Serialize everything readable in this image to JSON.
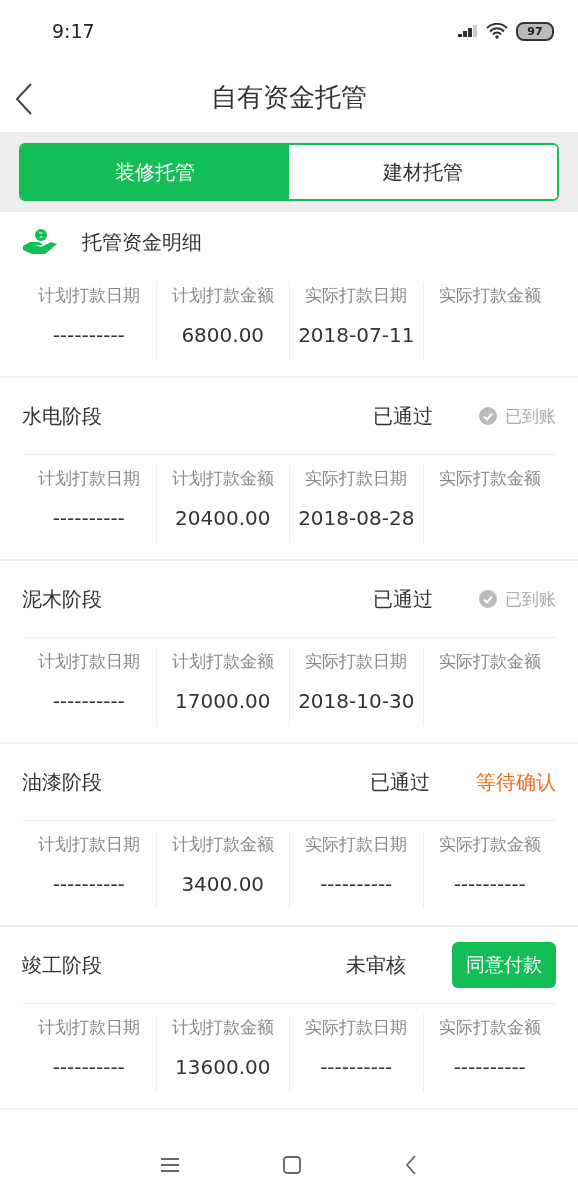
{
  "status_bar": {
    "time": "9:17",
    "battery": "97"
  },
  "header": {
    "title": "自有资金托管"
  },
  "tabs": [
    {
      "label": "装修托管",
      "selected": true
    },
    {
      "label": "建材托管",
      "selected": false
    }
  ],
  "section": {
    "title": "托管资金明细"
  },
  "blocks": [
    {
      "cells": [
        {
          "header": "计划打款日期",
          "value": "----------"
        },
        {
          "header": "计划打款金额",
          "value": "6800.00"
        },
        {
          "header": "实际打款日期",
          "value": "2018-07-11"
        },
        {
          "header": "实际打款金额"
        }
      ]
    },
    {
      "stage": {
        "name": "水电阶段",
        "review": "已通过",
        "payout": {
          "kind": "received",
          "label": "已到账"
        }
      },
      "cells": [
        {
          "header": "计划打款日期",
          "value": "----------"
        },
        {
          "header": "计划打款金额",
          "value": "20400.00"
        },
        {
          "header": "实际打款日期",
          "value": "2018-08-28"
        },
        {
          "header": "实际打款金额"
        }
      ]
    },
    {
      "stage": {
        "name": "泥木阶段",
        "review": "已通过",
        "payout": {
          "kind": "received",
          "label": "已到账"
        }
      },
      "cells": [
        {
          "header": "计划打款日期",
          "value": "----------"
        },
        {
          "header": "计划打款金额",
          "value": "17000.00"
        },
        {
          "header": "实际打款日期",
          "value": "2018-10-30"
        },
        {
          "header": "实际打款金额"
        }
      ]
    },
    {
      "stage": {
        "name": "油漆阶段",
        "review": "已通过",
        "payout": {
          "kind": "pending",
          "label": "等待确认"
        }
      },
      "cells": [
        {
          "header": "计划打款日期",
          "value": "----------"
        },
        {
          "header": "计划打款金额",
          "value": "3400.00"
        },
        {
          "header": "实际打款日期",
          "value": "----------"
        },
        {
          "header": "实际打款金额",
          "value": "----------"
        }
      ]
    },
    {
      "stage": {
        "name": "竣工阶段",
        "review": "未审核",
        "payout": {
          "kind": "button",
          "label": "同意付款"
        }
      },
      "cells": [
        {
          "header": "计划打款日期",
          "value": "----------"
        },
        {
          "header": "计划打款金额",
          "value": "13600.00"
        },
        {
          "header": "实际打款日期",
          "value": "----------"
        },
        {
          "header": "实际打款金额",
          "value": "----------"
        }
      ]
    }
  ]
}
